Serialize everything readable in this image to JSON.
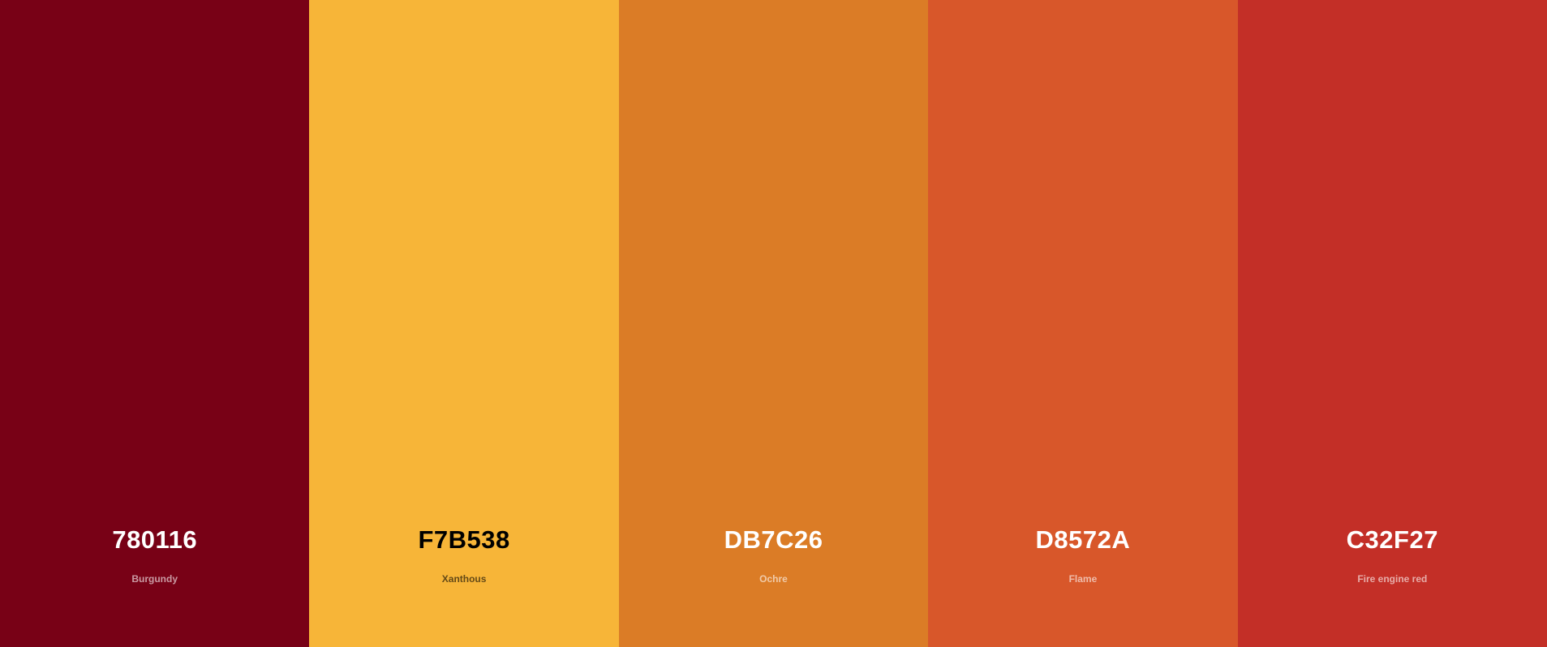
{
  "swatches": [
    {
      "hex": "780116",
      "name": "Burgundy",
      "color": "#780116",
      "text_color": "#ffffff"
    },
    {
      "hex": "F7B538",
      "name": "Xanthous",
      "color": "#F7B538",
      "text_color": "#000000"
    },
    {
      "hex": "DB7C26",
      "name": "Ochre",
      "color": "#DB7C26",
      "text_color": "#ffffff"
    },
    {
      "hex": "D8572A",
      "name": "Flame",
      "color": "#D8572A",
      "text_color": "#ffffff"
    },
    {
      "hex": "C32F27",
      "name": "Fire engine red",
      "color": "#C32F27",
      "text_color": "#ffffff"
    }
  ]
}
